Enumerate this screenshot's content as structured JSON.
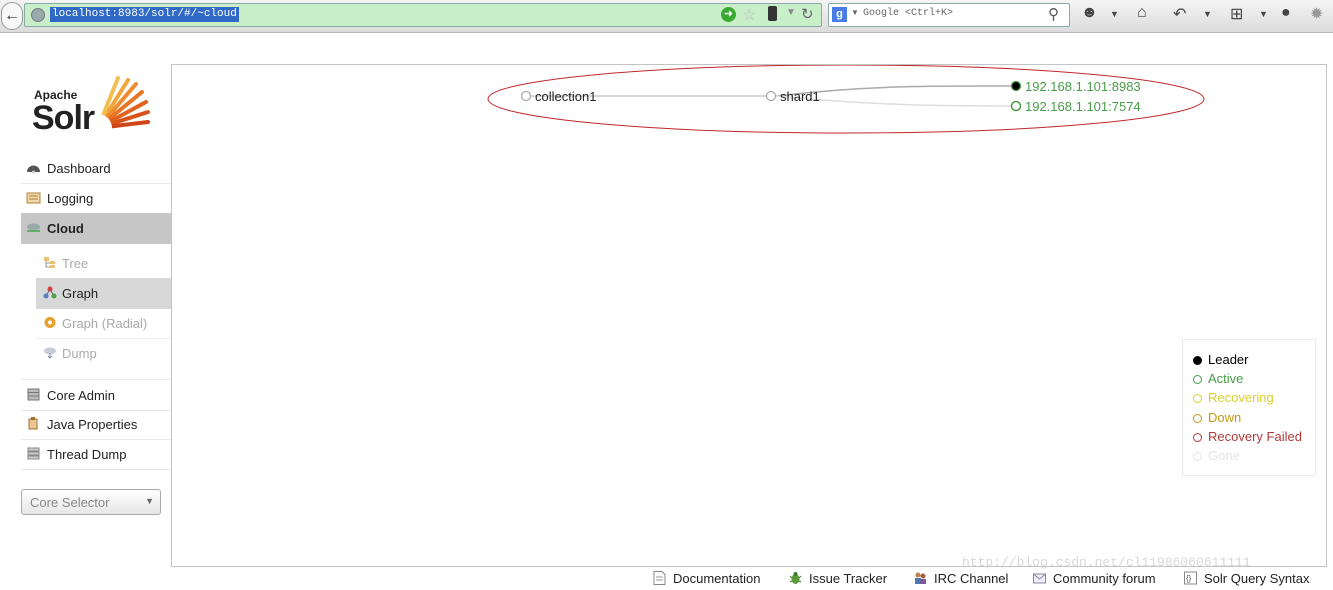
{
  "browser": {
    "url": "localhost:8983/solr/#/~cloud",
    "search_placeholder": "Google <Ctrl+K>"
  },
  "logo": {
    "apache": "Apache",
    "solr": "Solr"
  },
  "sidebar": {
    "items": [
      {
        "label": "Dashboard"
      },
      {
        "label": "Logging"
      },
      {
        "label": "Cloud"
      },
      {
        "label": "Core Admin"
      },
      {
        "label": "Java Properties"
      },
      {
        "label": "Thread Dump"
      }
    ],
    "cloud_sub": [
      {
        "label": "Tree"
      },
      {
        "label": "Graph"
      },
      {
        "label": "Graph (Radial)"
      },
      {
        "label": "Dump"
      }
    ],
    "core_selector": "Core Selector"
  },
  "graph": {
    "collection": "collection1",
    "shard": "shard1",
    "replicas": [
      {
        "host": "192.168.1.101:8983",
        "state": "leader"
      },
      {
        "host": "192.168.1.101:7574",
        "state": "active"
      }
    ]
  },
  "legend": [
    {
      "label": "Leader",
      "color": "#000000"
    },
    {
      "label": "Active",
      "color": "#4a9c4a"
    },
    {
      "label": "Recovering",
      "color": "#d7cf2a"
    },
    {
      "label": "Down",
      "color": "#c59a10"
    },
    {
      "label": "Recovery Failed",
      "color": "#b03a3a"
    },
    {
      "label": "Gone",
      "color": "#e4e4e4"
    }
  ],
  "footer": [
    {
      "label": "Documentation"
    },
    {
      "label": "Issue Tracker"
    },
    {
      "label": "IRC Channel"
    },
    {
      "label": "Community forum"
    },
    {
      "label": "Solr Query Syntax"
    }
  ],
  "watermark": "http://blog.csdn.net/cl11986060611111"
}
